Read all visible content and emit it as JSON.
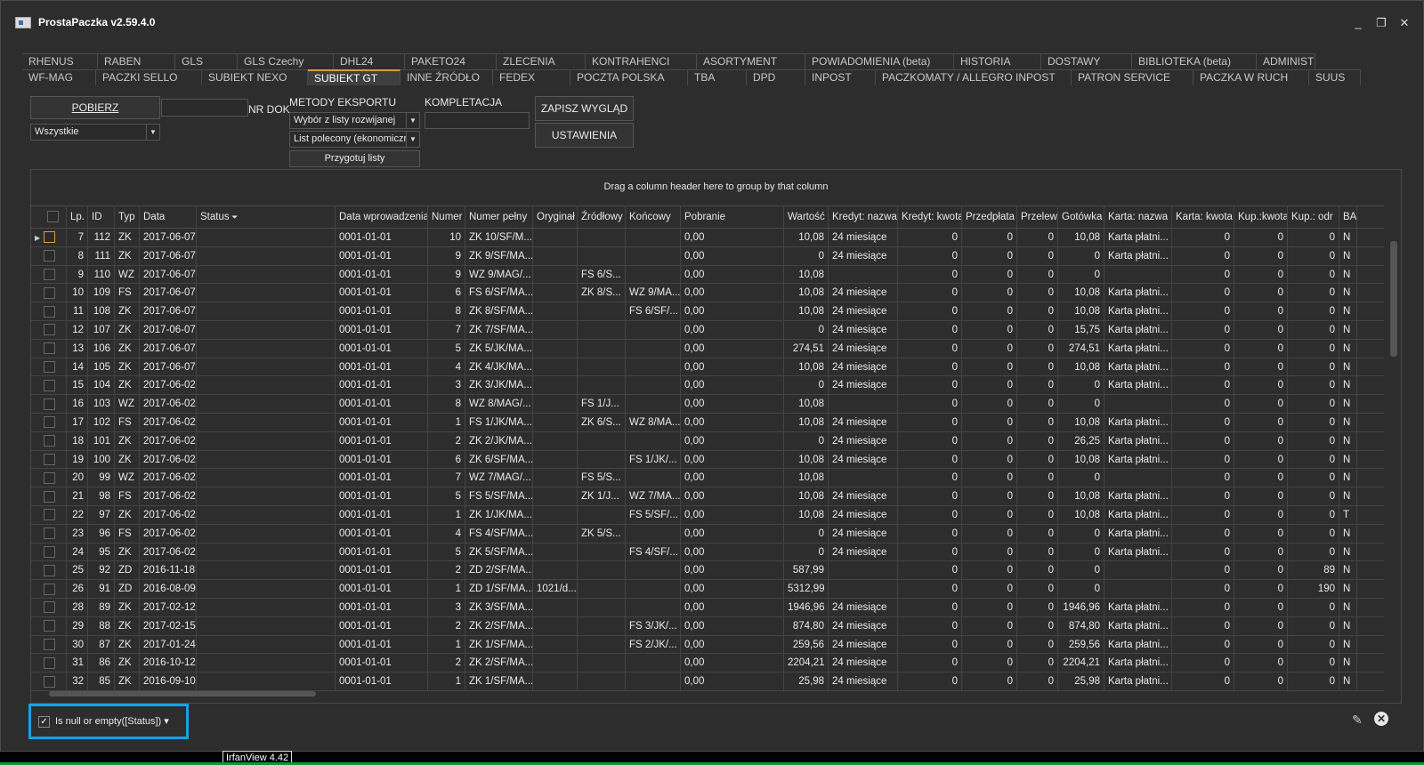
{
  "window": {
    "title": "ProstaPaczka v2.59.4.0",
    "controls": [
      "_",
      "❐",
      "✕"
    ]
  },
  "tabs": {
    "row1": [
      "RHENUS",
      "RABEN",
      "GLS",
      "GLS Czechy",
      "DHL24",
      "PAKETO24",
      "ZLECENIA",
      "KONTRAHENCI",
      "ASORTYMENT",
      "POWIADOMIENIA (beta)",
      "HISTORIA",
      "DOSTAWY",
      "BIBLIOTEKA (beta)",
      "ADMINISTRACJA"
    ],
    "row2": [
      "WF-MAG",
      "PACZKI SELLO",
      "SUBIEKT NEXO",
      "SUBIEKT GT",
      "INNE ŹRÓDŁO",
      "FEDEX",
      "POCZTA POLSKA",
      "TBA",
      "DPD",
      "INPOST",
      "PACZKOMATY / ALLEGRO INPOST",
      "PATRON SERVICE",
      "PACZKA W RUCH",
      "SUUS"
    ],
    "active": "SUBIEKT GT"
  },
  "toolbar": {
    "pobierz_label": "POBIERZ",
    "nrdok_value": "",
    "nrdok_label": "NR DOK",
    "filter_select": "Wszystkie",
    "metody_label": "METODY EKSPORTU",
    "metody_select1": "Wybór z listy rozwijanej",
    "metody_select2": "List polecony (ekonomiczr",
    "przygotuj_label": "Przygotuj listy",
    "kompletacja_label": "KOMPLETACJA",
    "kompletacja_value": "",
    "zapisz_label": "ZAPISZ WYGLĄD",
    "ustawienia_label": "USTAWIENIA"
  },
  "grid": {
    "group_hint": "Drag a column header here to group by that column",
    "columns": [
      "",
      "Lp.",
      "ID",
      "Typ",
      "Data",
      "Status",
      "Data wprowadzenia",
      "Numer",
      "Numer pełny",
      "Oryginał",
      "Źródłowy",
      "Końcowy",
      "Pobranie",
      "Wartość",
      "Kredyt: nazwa",
      "Kredyt: kwota",
      "Przedpłata",
      "Przelew",
      "Gotówka",
      "Karta: nazwa",
      "Karta: kwota",
      "Kup.:kwota",
      "Kup.: odr",
      "BA"
    ],
    "rows": [
      [
        "7",
        "112",
        "ZK",
        "2017-06-07",
        "",
        "0001-01-01",
        "10",
        "ZK 10/SF/M...",
        "",
        "",
        "",
        "0,00",
        "10,08",
        "24 miesiące",
        "0",
        "0",
        "0",
        "10,08",
        "Karta płatni...",
        "0",
        "0",
        "0",
        "N"
      ],
      [
        "8",
        "111",
        "ZK",
        "2017-06-07",
        "",
        "0001-01-01",
        "9",
        "ZK 9/SF/MA...",
        "",
        "",
        "",
        "0,00",
        "0",
        "24 miesiące",
        "0",
        "0",
        "0",
        "0",
        "Karta płatni...",
        "0",
        "0",
        "0",
        "N"
      ],
      [
        "9",
        "110",
        "WZ",
        "2017-06-07",
        "",
        "0001-01-01",
        "9",
        "WZ 9/MAG/...",
        "",
        "FS 6/S...",
        "",
        "0,00",
        "10,08",
        "",
        "0",
        "0",
        "0",
        "0",
        "",
        "0",
        "0",
        "0",
        "N"
      ],
      [
        "10",
        "109",
        "FS",
        "2017-06-07",
        "",
        "0001-01-01",
        "6",
        "FS 6/SF/MA...",
        "",
        "ZK 8/S...",
        "WZ 9/MA...",
        "0,00",
        "10,08",
        "24 miesiące",
        "0",
        "0",
        "0",
        "10,08",
        "Karta płatni...",
        "0",
        "0",
        "0",
        "N"
      ],
      [
        "11",
        "108",
        "ZK",
        "2017-06-07",
        "",
        "0001-01-01",
        "8",
        "ZK 8/SF/MA...",
        "",
        "",
        "FS 6/SF/...",
        "0,00",
        "10,08",
        "24 miesiące",
        "0",
        "0",
        "0",
        "10,08",
        "Karta płatni...",
        "0",
        "0",
        "0",
        "N"
      ],
      [
        "12",
        "107",
        "ZK",
        "2017-06-07",
        "",
        "0001-01-01",
        "7",
        "ZK 7/SF/MA...",
        "",
        "",
        "",
        "0,00",
        "0",
        "24 miesiące",
        "0",
        "0",
        "0",
        "15,75",
        "Karta płatni...",
        "0",
        "0",
        "0",
        "N"
      ],
      [
        "13",
        "106",
        "ZK",
        "2017-06-07",
        "",
        "0001-01-01",
        "5",
        "ZK 5/JK/MA...",
        "",
        "",
        "",
        "0,00",
        "274,51",
        "24 miesiące",
        "0",
        "0",
        "0",
        "274,51",
        "Karta płatni...",
        "0",
        "0",
        "0",
        "N"
      ],
      [
        "14",
        "105",
        "ZK",
        "2017-06-07",
        "",
        "0001-01-01",
        "4",
        "ZK 4/JK/MA...",
        "",
        "",
        "",
        "0,00",
        "10,08",
        "24 miesiące",
        "0",
        "0",
        "0",
        "10,08",
        "Karta płatni...",
        "0",
        "0",
        "0",
        "N"
      ],
      [
        "15",
        "104",
        "ZK",
        "2017-06-02",
        "",
        "0001-01-01",
        "3",
        "ZK 3/JK/MA...",
        "",
        "",
        "",
        "0,00",
        "0",
        "24 miesiące",
        "0",
        "0",
        "0",
        "0",
        "Karta płatni...",
        "0",
        "0",
        "0",
        "N"
      ],
      [
        "16",
        "103",
        "WZ",
        "2017-06-02",
        "",
        "0001-01-01",
        "8",
        "WZ 8/MAG/...",
        "",
        "FS 1/J...",
        "",
        "0,00",
        "10,08",
        "",
        "0",
        "0",
        "0",
        "0",
        "",
        "0",
        "0",
        "0",
        "N"
      ],
      [
        "17",
        "102",
        "FS",
        "2017-06-02",
        "",
        "0001-01-01",
        "1",
        "FS 1/JK/MA...",
        "",
        "ZK 6/S...",
        "WZ 8/MA...",
        "0,00",
        "10,08",
        "24 miesiące",
        "0",
        "0",
        "0",
        "10,08",
        "Karta płatni...",
        "0",
        "0",
        "0",
        "N"
      ],
      [
        "18",
        "101",
        "ZK",
        "2017-06-02",
        "",
        "0001-01-01",
        "2",
        "ZK 2/JK/MA...",
        "",
        "",
        "",
        "0,00",
        "0",
        "24 miesiące",
        "0",
        "0",
        "0",
        "26,25",
        "Karta płatni...",
        "0",
        "0",
        "0",
        "N"
      ],
      [
        "19",
        "100",
        "ZK",
        "2017-06-02",
        "",
        "0001-01-01",
        "6",
        "ZK 6/SF/MA...",
        "",
        "",
        "FS 1/JK/...",
        "0,00",
        "10,08",
        "24 miesiące",
        "0",
        "0",
        "0",
        "10,08",
        "Karta płatni...",
        "0",
        "0",
        "0",
        "N"
      ],
      [
        "20",
        "99",
        "WZ",
        "2017-06-02",
        "",
        "0001-01-01",
        "7",
        "WZ 7/MAG/...",
        "",
        "FS 5/S...",
        "",
        "0,00",
        "10,08",
        "",
        "0",
        "0",
        "0",
        "0",
        "",
        "0",
        "0",
        "0",
        "N"
      ],
      [
        "21",
        "98",
        "FS",
        "2017-06-02",
        "",
        "0001-01-01",
        "5",
        "FS 5/SF/MA...",
        "",
        "ZK 1/J...",
        "WZ 7/MA...",
        "0,00",
        "10,08",
        "24 miesiące",
        "0",
        "0",
        "0",
        "10,08",
        "Karta płatni...",
        "0",
        "0",
        "0",
        "N"
      ],
      [
        "22",
        "97",
        "ZK",
        "2017-06-02",
        "",
        "0001-01-01",
        "1",
        "ZK 1/JK/MA...",
        "",
        "",
        "FS 5/SF/...",
        "0,00",
        "10,08",
        "24 miesiące",
        "0",
        "0",
        "0",
        "10,08",
        "Karta płatni...",
        "0",
        "0",
        "0",
        "T"
      ],
      [
        "23",
        "96",
        "FS",
        "2017-06-02",
        "",
        "0001-01-01",
        "4",
        "FS 4/SF/MA...",
        "",
        "ZK 5/S...",
        "",
        "0,00",
        "0",
        "24 miesiące",
        "0",
        "0",
        "0",
        "0",
        "Karta płatni...",
        "0",
        "0",
        "0",
        "N"
      ],
      [
        "24",
        "95",
        "ZK",
        "2017-06-02",
        "",
        "0001-01-01",
        "5",
        "ZK 5/SF/MA...",
        "",
        "",
        "FS 4/SF/...",
        "0,00",
        "0",
        "24 miesiące",
        "0",
        "0",
        "0",
        "0",
        "Karta płatni...",
        "0",
        "0",
        "0",
        "N"
      ],
      [
        "25",
        "92",
        "ZD",
        "2016-11-18",
        "",
        "0001-01-01",
        "2",
        "ZD 2/SF/MA...",
        "",
        "",
        "",
        "0,00",
        "587,99",
        "",
        "0",
        "0",
        "0",
        "0",
        "",
        "0",
        "0",
        "89",
        "N"
      ],
      [
        "26",
        "91",
        "ZD",
        "2016-08-09",
        "",
        "0001-01-01",
        "1",
        "ZD 1/SF/MA...",
        "1021/d...",
        "",
        "",
        "0,00",
        "5312,99",
        "",
        "0",
        "0",
        "0",
        "0",
        "",
        "0",
        "0",
        "190",
        "N"
      ],
      [
        "28",
        "89",
        "ZK",
        "2017-02-12",
        "",
        "0001-01-01",
        "3",
        "ZK 3/SF/MA...",
        "",
        "",
        "",
        "0,00",
        "1946,96",
        "24 miesiące",
        "0",
        "0",
        "0",
        "1946,96",
        "Karta płatni...",
        "0",
        "0",
        "0",
        "N"
      ],
      [
        "29",
        "88",
        "ZK",
        "2017-02-15",
        "",
        "0001-01-01",
        "2",
        "ZK 2/SF/MA...",
        "",
        "",
        "FS 3/JK/...",
        "0,00",
        "874,80",
        "24 miesiące",
        "0",
        "0",
        "0",
        "874,80",
        "Karta płatni...",
        "0",
        "0",
        "0",
        "N"
      ],
      [
        "30",
        "87",
        "ZK",
        "2017-01-24",
        "",
        "0001-01-01",
        "1",
        "ZK 1/SF/MA...",
        "",
        "",
        "FS 2/JK/...",
        "0,00",
        "259,56",
        "24 miesiące",
        "0",
        "0",
        "0",
        "259,56",
        "Karta płatni...",
        "0",
        "0",
        "0",
        "N"
      ],
      [
        "31",
        "86",
        "ZK",
        "2016-10-12",
        "",
        "0001-01-01",
        "2",
        "ZK 2/SF/MA...",
        "",
        "",
        "",
        "0,00",
        "2204,21",
        "24 miesiące",
        "0",
        "0",
        "0",
        "2204,21",
        "Karta płatni...",
        "0",
        "0",
        "0",
        "N"
      ],
      [
        "32",
        "85",
        "ZK",
        "2016-09-10",
        "",
        "0001-01-01",
        "1",
        "ZK 1/SF/MA...",
        "",
        "",
        "",
        "0,00",
        "25,98",
        "24 miesiące",
        "0",
        "0",
        "0",
        "25,98",
        "Karta płatni...",
        "0",
        "0",
        "0",
        "N"
      ]
    ]
  },
  "filter": {
    "text": "Is null or empty([Status]) ▾",
    "checked": "✓"
  },
  "footer": {
    "edit_icon": "✎",
    "clear_icon": "✕"
  },
  "tooltip": "IrfanView 4.42"
}
